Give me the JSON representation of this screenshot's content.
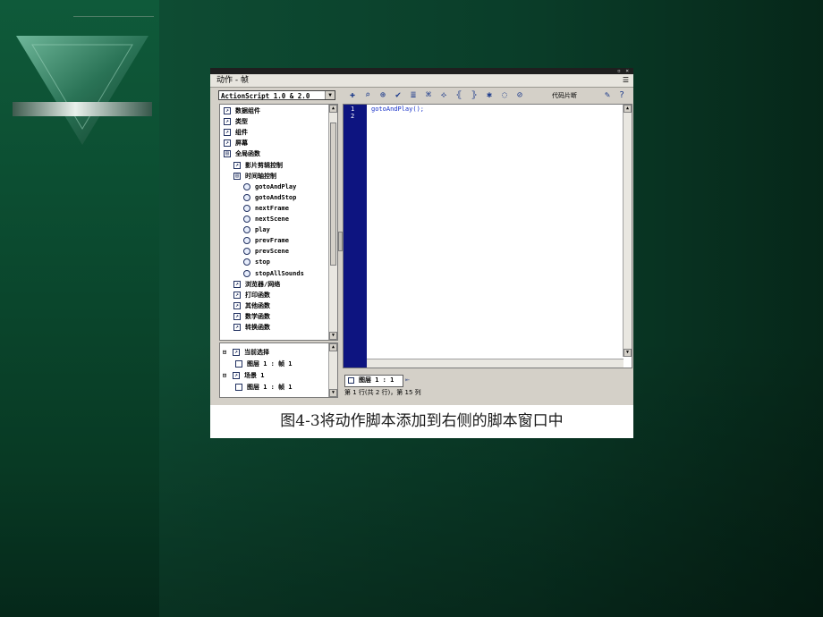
{
  "colors": {
    "slide_green": "#0b4a2f",
    "gutter_blue": "#0d1480",
    "code_blue": "#1630c8"
  },
  "panel": {
    "title": "动作 - 帧",
    "menu_icon": "menu-icon"
  },
  "language_select": {
    "value": "ActionScript 1.0 & 2.0"
  },
  "toolbar": {
    "icons": [
      "add-icon",
      "find-icon",
      "target-icon",
      "check-syntax-icon",
      "auto-format-icon",
      "code-hint-icon",
      "debug-icon",
      "collapse-icon",
      "expand-icon",
      "comment-icon",
      "uncomment-icon",
      "help-icon"
    ],
    "code_snippet_label": "代码片断"
  },
  "tree": {
    "items": [
      {
        "label": "数据组件",
        "level": 0,
        "icon": "book-icon"
      },
      {
        "label": "类型",
        "level": 0,
        "icon": "book-icon"
      },
      {
        "label": "组件",
        "level": 0,
        "icon": "book-icon"
      },
      {
        "label": "屏幕",
        "level": 0,
        "icon": "book-icon"
      },
      {
        "label": "全局函数",
        "level": 0,
        "icon": "open-book-icon"
      },
      {
        "label": "影片剪辑控制",
        "level": 1,
        "icon": "book-icon"
      },
      {
        "label": "时间轴控制",
        "level": 1,
        "icon": "open-book-icon"
      },
      {
        "label": "gotoAndPlay",
        "level": 2,
        "icon": "function-icon"
      },
      {
        "label": "gotoAndStop",
        "level": 2,
        "icon": "function-icon"
      },
      {
        "label": "nextFrame",
        "level": 2,
        "icon": "function-icon"
      },
      {
        "label": "nextScene",
        "level": 2,
        "icon": "function-icon"
      },
      {
        "label": "play",
        "level": 2,
        "icon": "function-icon"
      },
      {
        "label": "prevFrame",
        "level": 2,
        "icon": "function-icon"
      },
      {
        "label": "prevScene",
        "level": 2,
        "icon": "function-icon"
      },
      {
        "label": "stop",
        "level": 2,
        "icon": "function-icon"
      },
      {
        "label": "stopAllSounds",
        "level": 2,
        "icon": "function-icon"
      },
      {
        "label": "浏览器/网络",
        "level": 1,
        "icon": "book-icon"
      },
      {
        "label": "打印函数",
        "level": 1,
        "icon": "book-icon"
      },
      {
        "label": "其他函数",
        "level": 1,
        "icon": "book-icon"
      },
      {
        "label": "数学函数",
        "level": 1,
        "icon": "book-icon"
      },
      {
        "label": "转换函数",
        "level": 1,
        "icon": "book-icon"
      }
    ]
  },
  "scene_tree": {
    "items": [
      {
        "label": "当前选择",
        "level": 0,
        "toggle": "⊟"
      },
      {
        "label": "图层 1 : 帧 1",
        "level": 1,
        "toggle": ""
      },
      {
        "label": "场景 1",
        "level": 0,
        "toggle": "⊟"
      },
      {
        "label": "图层 1 : 帧 1",
        "level": 1,
        "toggle": ""
      }
    ]
  },
  "editor": {
    "line_numbers": [
      "1",
      "2"
    ],
    "code": "gotoAndPlay();"
  },
  "layer_tab": {
    "label": "图层 1 : 1"
  },
  "status_bar": {
    "text": "第 1 行(共 2 行)，第 15 列"
  },
  "caption": "图4-3将动作脚本添加到右侧的脚本窗口中"
}
